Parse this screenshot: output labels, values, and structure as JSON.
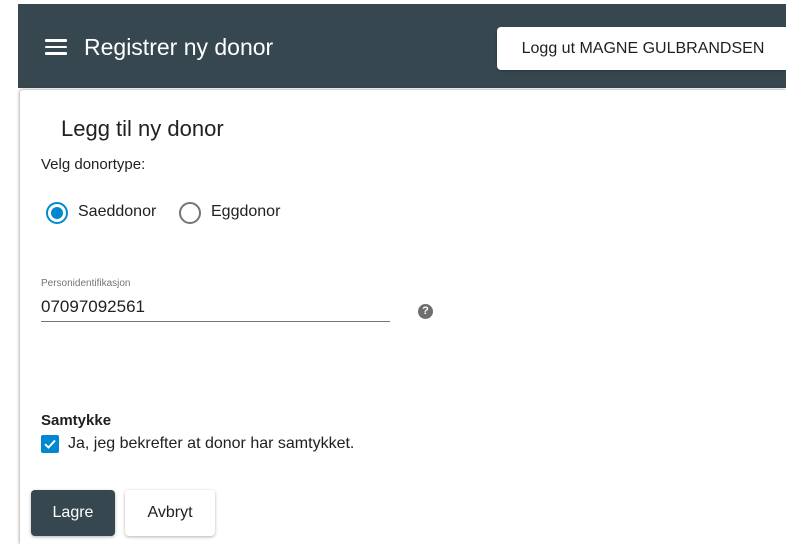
{
  "colors": {
    "topbar": "#37474f",
    "accent": "#0288d1",
    "primary_button": "#37474f"
  },
  "header": {
    "menu_icon": "hamburger-menu-icon",
    "title": "Registrer ny donor",
    "logout_label": "Logg ut MAGNE GULBRANDSEN"
  },
  "form": {
    "title": "Legg til ny donor",
    "donor_type_label": "Velg donortype:",
    "donor_types": [
      {
        "label": "Saeddonor",
        "selected": true
      },
      {
        "label": "Eggdonor",
        "selected": false
      }
    ],
    "id_field": {
      "label": "Personidentifikasjon",
      "value": "07097092561",
      "help_icon": "question-circle-icon",
      "help_glyph": "?"
    },
    "consent": {
      "title": "Samtykke",
      "checkbox_label": "Ja, jeg bekrefter at donor har samtykket.",
      "checked": true
    },
    "save_label": "Lagre",
    "cancel_label": "Avbryt"
  }
}
